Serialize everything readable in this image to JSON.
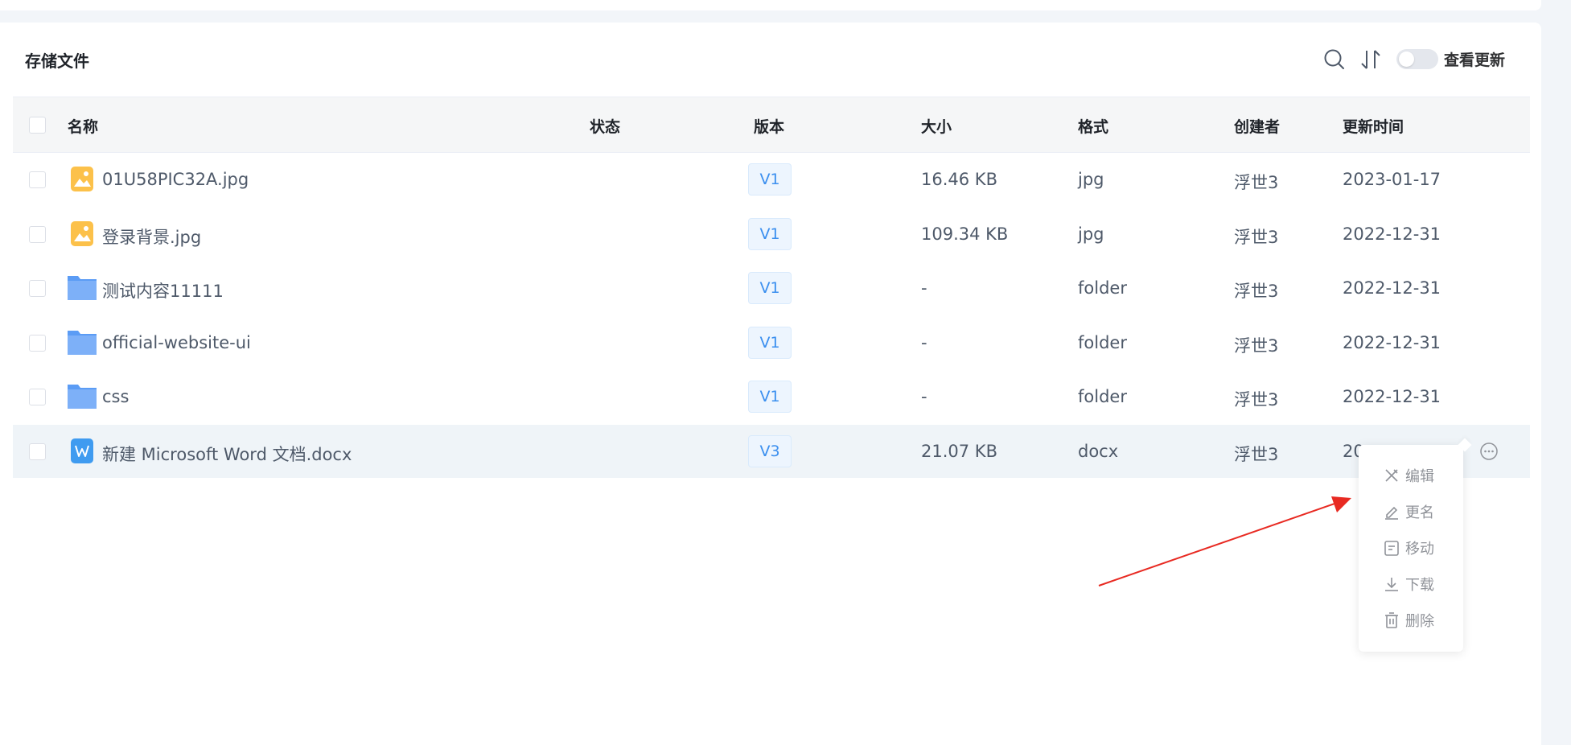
{
  "card": {
    "title": "存储文件",
    "toggle_label": "查看更新"
  },
  "table": {
    "headers": {
      "name": "名称",
      "status": "状态",
      "version": "版本",
      "size": "大小",
      "format": "格式",
      "creator": "创建者",
      "updated": "更新时间"
    },
    "rows": [
      {
        "name": "01U58PIC32A.jpg",
        "status": "",
        "version": "V1",
        "size": "16.46 KB",
        "format": "jpg",
        "creator": "浮世3",
        "updated": "2023-01-17",
        "icon": "image-file-icon"
      },
      {
        "name": "登录背景.jpg",
        "status": "",
        "version": "V1",
        "size": "109.34 KB",
        "format": "jpg",
        "creator": "浮世3",
        "updated": "2022-12-31",
        "icon": "image-file-icon"
      },
      {
        "name": "测试内容11111",
        "status": "",
        "version": "V1",
        "size": "-",
        "format": "folder",
        "creator": "浮世3",
        "updated": "2022-12-31",
        "icon": "folder-icon"
      },
      {
        "name": "official-website-ui",
        "status": "",
        "version": "V1",
        "size": "-",
        "format": "folder",
        "creator": "浮世3",
        "updated": "2022-12-31",
        "icon": "folder-icon"
      },
      {
        "name": "css",
        "status": "",
        "version": "V1",
        "size": "-",
        "format": "folder",
        "creator": "浮世3",
        "updated": "2022-12-31",
        "icon": "folder-icon"
      },
      {
        "name": "新建 Microsoft Word 文档.docx",
        "status": "",
        "version": "V3",
        "size": "21.07 KB",
        "format": "docx",
        "creator": "浮世3",
        "updated": "20",
        "icon": "word-file-icon"
      }
    ]
  },
  "menu": {
    "items": [
      {
        "label": "编辑",
        "icon": "edit-icon"
      },
      {
        "label": "更名",
        "icon": "rename-icon"
      },
      {
        "label": "移动",
        "icon": "move-icon"
      },
      {
        "label": "下载",
        "icon": "download-icon"
      },
      {
        "label": "删除",
        "icon": "delete-icon"
      }
    ]
  },
  "colors": {
    "accent": "#3b8fef",
    "folder": "#5b9cf5",
    "image_icon": "#fcc14a",
    "annotation_arrow": "#e82a22"
  }
}
